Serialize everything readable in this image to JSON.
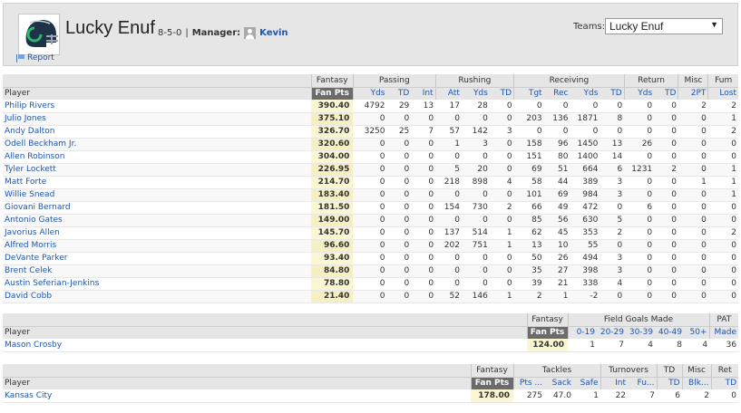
{
  "header": {
    "team_name": "Lucky Enuf",
    "record": "8-5-0",
    "manager_label": "Manager:",
    "manager_name": "Kevin",
    "report_label": "Report",
    "teams_label": "Teams:",
    "teams_selected": "Lucky Enuf"
  },
  "offense": {
    "group_headers": [
      "Fantasy",
      "Passing",
      "Rushing",
      "Receiving",
      "Return",
      "Misc",
      "Fum"
    ],
    "player_label": "Player",
    "columns": [
      "Fan Pts",
      "Yds",
      "TD",
      "Int",
      "Att",
      "Yds",
      "TD",
      "Tgt",
      "Rec",
      "Yds",
      "TD",
      "Yds",
      "TD",
      "2PT",
      "Lost"
    ],
    "rows": [
      {
        "name": "Philip Rivers",
        "pts": "390.40",
        "stats": [
          "4792",
          "29",
          "13",
          "17",
          "28",
          "0",
          "0",
          "0",
          "0",
          "0",
          "0",
          "0",
          "2",
          "2"
        ]
      },
      {
        "name": "Julio Jones",
        "pts": "375.10",
        "stats": [
          "0",
          "0",
          "0",
          "0",
          "0",
          "0",
          "203",
          "136",
          "1871",
          "8",
          "0",
          "0",
          "0",
          "1"
        ]
      },
      {
        "name": "Andy Dalton",
        "pts": "326.70",
        "stats": [
          "3250",
          "25",
          "7",
          "57",
          "142",
          "3",
          "0",
          "0",
          "0",
          "0",
          "0",
          "0",
          "0",
          "2"
        ]
      },
      {
        "name": "Odell Beckham Jr.",
        "pts": "320.60",
        "stats": [
          "0",
          "0",
          "0",
          "1",
          "3",
          "0",
          "158",
          "96",
          "1450",
          "13",
          "26",
          "0",
          "0",
          "0"
        ]
      },
      {
        "name": "Allen Robinson",
        "pts": "304.00",
        "stats": [
          "0",
          "0",
          "0",
          "0",
          "0",
          "0",
          "151",
          "80",
          "1400",
          "14",
          "0",
          "0",
          "0",
          "0"
        ]
      },
      {
        "name": "Tyler Lockett",
        "pts": "226.95",
        "stats": [
          "0",
          "0",
          "0",
          "5",
          "20",
          "0",
          "69",
          "51",
          "664",
          "6",
          "1231",
          "2",
          "0",
          "1"
        ]
      },
      {
        "name": "Matt Forte",
        "pts": "214.70",
        "stats": [
          "0",
          "0",
          "0",
          "218",
          "898",
          "4",
          "58",
          "44",
          "389",
          "3",
          "0",
          "0",
          "1",
          "1"
        ]
      },
      {
        "name": "Willie Snead",
        "pts": "183.40",
        "stats": [
          "0",
          "0",
          "0",
          "0",
          "0",
          "0",
          "101",
          "69",
          "984",
          "3",
          "0",
          "0",
          "0",
          "1"
        ]
      },
      {
        "name": "Giovani Bernard",
        "pts": "181.50",
        "stats": [
          "0",
          "0",
          "0",
          "154",
          "730",
          "2",
          "66",
          "49",
          "472",
          "0",
          "6",
          "0",
          "0",
          "0"
        ]
      },
      {
        "name": "Antonio Gates",
        "pts": "149.00",
        "stats": [
          "0",
          "0",
          "0",
          "0",
          "0",
          "0",
          "85",
          "56",
          "630",
          "5",
          "0",
          "0",
          "0",
          "0"
        ]
      },
      {
        "name": "Javorius Allen",
        "pts": "145.70",
        "stats": [
          "0",
          "0",
          "0",
          "137",
          "514",
          "1",
          "62",
          "45",
          "353",
          "2",
          "0",
          "0",
          "0",
          "2"
        ]
      },
      {
        "name": "Alfred Morris",
        "pts": "96.60",
        "stats": [
          "0",
          "0",
          "0",
          "202",
          "751",
          "1",
          "13",
          "10",
          "55",
          "0",
          "0",
          "0",
          "0",
          "0"
        ]
      },
      {
        "name": "DeVante Parker",
        "pts": "93.40",
        "stats": [
          "0",
          "0",
          "0",
          "0",
          "0",
          "0",
          "50",
          "26",
          "494",
          "3",
          "0",
          "0",
          "0",
          "0"
        ]
      },
      {
        "name": "Brent Celek",
        "pts": "84.80",
        "stats": [
          "0",
          "0",
          "0",
          "0",
          "0",
          "0",
          "35",
          "27",
          "398",
          "3",
          "0",
          "0",
          "0",
          "0"
        ]
      },
      {
        "name": "Austin Seferian-Jenkins",
        "pts": "78.80",
        "stats": [
          "0",
          "0",
          "0",
          "0",
          "0",
          "0",
          "39",
          "21",
          "338",
          "4",
          "0",
          "0",
          "0",
          "0"
        ]
      },
      {
        "name": "David Cobb",
        "pts": "21.40",
        "stats": [
          "0",
          "0",
          "0",
          "52",
          "146",
          "1",
          "2",
          "1",
          "-2",
          "0",
          "0",
          "0",
          "0",
          "0"
        ]
      }
    ]
  },
  "kicker": {
    "group_headers": [
      "Fantasy",
      "Field Goals Made",
      "PAT"
    ],
    "player_label": "Player",
    "columns": [
      "Fan Pts",
      "0-19",
      "20-29",
      "30-39",
      "40-49",
      "50+",
      "Made"
    ],
    "rows": [
      {
        "name": "Mason Crosby",
        "pts": "124.00",
        "stats": [
          "1",
          "7",
          "4",
          "8",
          "4",
          "36"
        ]
      }
    ]
  },
  "defense": {
    "group_headers": [
      "Fantasy",
      "Tackles",
      "Turnovers",
      "TD",
      "Misc",
      "Ret"
    ],
    "player_label": "Player",
    "columns": [
      "Fan Pts",
      "Pts ...",
      "Sack",
      "Safe",
      "Int",
      "Fu...",
      "TD",
      "Blk...",
      "TD"
    ],
    "rows": [
      {
        "name": "Kansas City",
        "pts": "178.00",
        "stats": [
          "275",
          "47.0",
          "1",
          "22",
          "7",
          "6",
          "2",
          "0"
        ]
      }
    ]
  },
  "colors": {
    "header_bg": "#e6e6e6",
    "link": "#2255aa",
    "fan_pts_header": "#6b6b6b",
    "fan_pts_cell": "#fbf6d2"
  },
  "icons": [
    "helmet-logo-icon",
    "report-flag-icon",
    "manager-avatar-icon",
    "dropdown-arrow-icon"
  ]
}
